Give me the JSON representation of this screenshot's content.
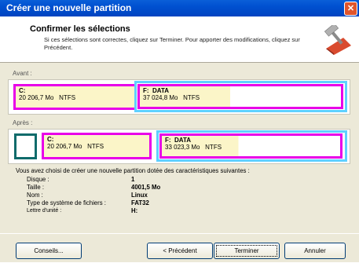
{
  "window": {
    "title": "Créer une nouvelle partition",
    "close_icon": "close-icon"
  },
  "header": {
    "title": "Confirmer les sélections",
    "description": "Si ces sélections sont correctes, cliquez sur Terminer. Pour apporter des modifications, cliquez sur Précédent.",
    "icon": "wizard-hammer-icon"
  },
  "before": {
    "label": "Avant :",
    "partitions": [
      {
        "letter": "C:",
        "name": "",
        "size": "20 206,7 Mo",
        "fs": "NTFS"
      },
      {
        "letter": "F:",
        "name": "DATA",
        "size": "37 024,8 Mo",
        "fs": "NTFS"
      }
    ]
  },
  "after": {
    "label": "Après :",
    "partitions": [
      {
        "letter": "C:",
        "name": "",
        "size": "20 206,7 Mo",
        "fs": "NTFS"
      },
      {
        "letter": "F:",
        "name": "DATA",
        "size": "33 023,3 Mo",
        "fs": "NTFS"
      }
    ]
  },
  "info": {
    "intro": "Vous avez choisi de créer une nouvelle partition dotée des caractéristiques suivantes :",
    "rows": [
      {
        "label": "Disque :",
        "value": "1"
      },
      {
        "label": "Taille :",
        "value": "4001,5 Mo"
      },
      {
        "label": "Nom :",
        "value": "Linux"
      },
      {
        "label": "Type de système de fichiers :",
        "value": "FAT32"
      },
      {
        "label": "Lettre d'unité :",
        "value": "H:"
      }
    ]
  },
  "buttons": {
    "conseils": "Conseils...",
    "precedent": "< Précédent",
    "terminer": "Terminer",
    "annuler": "Annuler"
  },
  "colors": {
    "titlebar": "#0050d0",
    "partition_fill": "#fbf5c8",
    "magenta": "#e800e8",
    "cyan": "#5fd0ff"
  }
}
